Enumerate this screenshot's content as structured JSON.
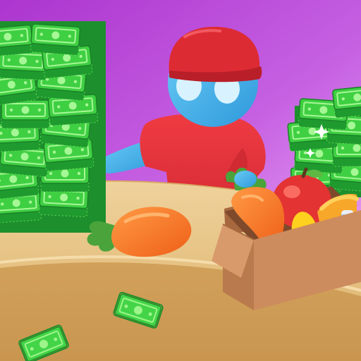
{
  "scene": {
    "description_label": "",
    "colors": {
      "background_top": "#b23fd6",
      "background_bottom": "#e79af4",
      "counter_top": "#e9c98d",
      "counter_front": "#d9ac62",
      "money_green": "#36c53c",
      "money_light": "#8cf07f",
      "money_dark": "#1f8e2b",
      "shirt_red": "#e8323a",
      "cap_red": "#dd2b34",
      "skin_blue": "#49b6ec",
      "carrot_orange": "#ff7a2a",
      "leaf_green": "#4aa43b",
      "box_brown": "#c8875b",
      "apple_red": "#e63434",
      "banana_yellow": "#ffd11f",
      "bottle_white": "#f5f8ff"
    },
    "icons": {
      "cashier": "cashier-character",
      "money_stack": "money-stack-icon",
      "money_bill": "money-bill-icon",
      "carrot": "carrot-icon",
      "grocery_box": "grocery-box-icon",
      "sparkle": "sparkle-icon"
    }
  }
}
